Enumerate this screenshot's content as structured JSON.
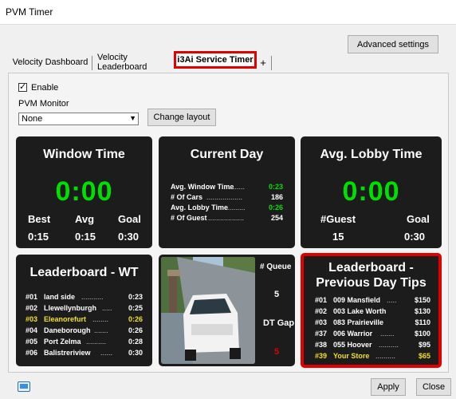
{
  "window": {
    "title": "PVM Timer"
  },
  "toolbar": {
    "advanced_label": "Advanced settings"
  },
  "tabs": [
    {
      "label": "Velocity Dashboard"
    },
    {
      "label": "Velocity Leaderboard"
    },
    {
      "label": "i3Ai Service Timer"
    },
    {
      "label": "+"
    }
  ],
  "settings": {
    "enable_label": "Enable",
    "enable_checked": true,
    "monitor_label": "PVM Monitor",
    "monitor_value": "None",
    "change_layout_label": "Change layout"
  },
  "window_time": {
    "title": "Window Time",
    "value": "0:00",
    "stats": [
      {
        "label": "Best",
        "value": "0:15"
      },
      {
        "label": "Avg",
        "value": "0:15"
      },
      {
        "label": "Goal",
        "value": "0:30"
      }
    ]
  },
  "current_day": {
    "title": "Current Day",
    "rows": [
      {
        "label": "Avg. Window Time",
        "value": "0:23",
        "highlight": true
      },
      {
        "label": "# Of Cars",
        "value": "186",
        "highlight": false
      },
      {
        "label": "Avg. Lobby Time",
        "value": "0:26",
        "highlight": true
      },
      {
        "label": "# Of Guest",
        "value": "254",
        "highlight": false
      }
    ]
  },
  "lobby_time": {
    "title": "Avg. Lobby Time",
    "value": "0:00",
    "stats": [
      {
        "label": "#Guest",
        "value": "15"
      },
      {
        "label": "Goal",
        "value": "0:30"
      }
    ]
  },
  "leaderboard_wt": {
    "title": "Leaderboard - WT",
    "rows": [
      {
        "rank": "#01",
        "name": "land side",
        "value": "0:23",
        "highlight": false
      },
      {
        "rank": "#02",
        "name": "Llewellynburgh",
        "value": "0:25",
        "highlight": false
      },
      {
        "rank": "#03",
        "name": "Eleanorefurt",
        "value": "0:26",
        "highlight": true
      },
      {
        "rank": "#04",
        "name": "Daneborough",
        "value": "0:26",
        "highlight": false
      },
      {
        "rank": "#05",
        "name": "Port Zelma",
        "value": "0:28",
        "highlight": false
      },
      {
        "rank": "#06",
        "name": "Balistreriview",
        "value": "0:30",
        "highlight": false
      }
    ]
  },
  "camera": {
    "queue_label": "# Queue",
    "queue_value": "5",
    "dt_gap_label": "DT Gap",
    "dt_gap_value": "5"
  },
  "leaderboard_tips": {
    "title_line1": "Leaderboard -",
    "title_line2": "Previous Day Tips",
    "rows": [
      {
        "rank": "#01",
        "name": "009 Mansfield",
        "value": "$150",
        "highlight": false
      },
      {
        "rank": "#02",
        "name": "003 Lake Worth",
        "value": "$130",
        "highlight": false
      },
      {
        "rank": "#03",
        "name": "083 Prairieville",
        "value": "$110",
        "highlight": false
      },
      {
        "rank": "#37",
        "name": "006 Warrior",
        "value": "$100",
        "highlight": false
      },
      {
        "rank": "#38",
        "name": "055 Hoover",
        "value": "$95",
        "highlight": false
      },
      {
        "rank": "#39",
        "name": "Your Store",
        "value": "$65",
        "highlight": true
      }
    ]
  },
  "footer": {
    "apply_label": "Apply",
    "close_label": "Close"
  },
  "colors": {
    "accent_green": "#00e000",
    "highlight_yellow": "#f0e020",
    "alert_red": "#e00000",
    "tile_bg": "#1c1c1c"
  }
}
